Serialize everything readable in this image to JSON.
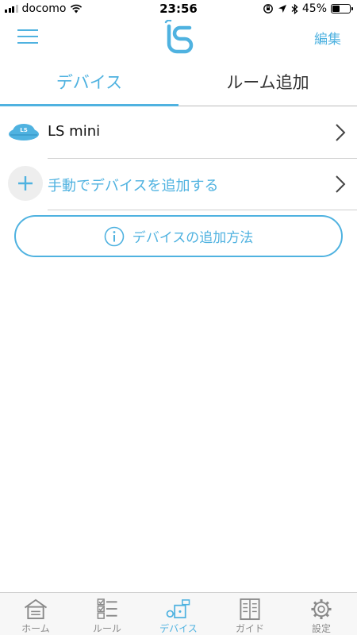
{
  "status_bar": {
    "carrier": "docomo",
    "time": "23:56",
    "battery_percent": "45%",
    "battery_level": 0.45,
    "signal_bars_active": 3,
    "signal_bars_total": 4,
    "icons": [
      "wifi-icon",
      "orientation-lock-icon",
      "location-arrow-icon",
      "bluetooth-icon",
      "battery-icon"
    ]
  },
  "nav": {
    "menu_icon": "hamburger-menu-icon",
    "logo_text": "LS",
    "edit_label": "編集"
  },
  "tabs": [
    {
      "label": "デバイス",
      "active": true
    },
    {
      "label": "ルーム追加",
      "active": false
    }
  ],
  "devices": [
    {
      "name": "LS mini",
      "icon": "ls-mini-device-icon"
    }
  ],
  "add_device": {
    "label": "手動でデバイスを追加する",
    "icon": "plus-icon"
  },
  "help_button": {
    "label": "デバイスの追加方法",
    "icon": "info-icon"
  },
  "tab_bar": [
    {
      "label": "ホーム",
      "icon": "home-icon",
      "active": false
    },
    {
      "label": "ルール",
      "icon": "rule-checklist-icon",
      "active": false
    },
    {
      "label": "デバイス",
      "icon": "device-icon",
      "active": true
    },
    {
      "label": "ガイド",
      "icon": "guide-book-icon",
      "active": false
    },
    {
      "label": "設定",
      "icon": "settings-gear-icon",
      "active": false
    }
  ],
  "colors": {
    "accent": "#4fb2e0",
    "text": "#222222",
    "inactive": "#8a8a8a",
    "separator": "#cfcfcf"
  }
}
